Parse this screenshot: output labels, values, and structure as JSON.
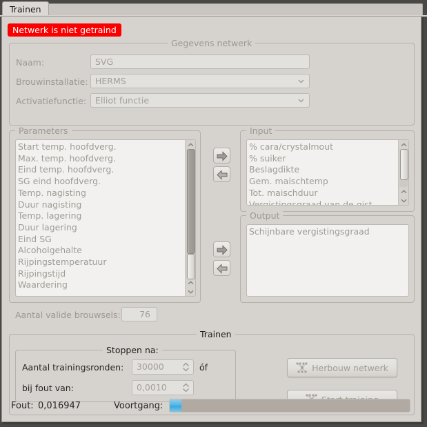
{
  "window": {
    "background_color": "#4a4846",
    "panel_color": "#d6d3ce"
  },
  "tabs": [
    {
      "label": "Trainen",
      "selected": true
    }
  ],
  "status_banner": {
    "text": "Netwerk is niet getraind",
    "background_color": "#fa0000",
    "text_color": "#ffffff"
  },
  "network_data_group": {
    "title": "Gegevens netwerk",
    "fields": [
      {
        "label": "Naam:",
        "value": "SVG",
        "type": "text"
      },
      {
        "label": "Brouwinstallatie:",
        "value": "HERMS",
        "type": "combobox"
      },
      {
        "label": "Activatiefunctie:",
        "value": "Elliot functie",
        "type": "combobox"
      }
    ]
  },
  "parameters_group": {
    "title": "Parameters",
    "items": [
      "Start temp. hoofdverg.",
      "Max. temp. hoofdverg.",
      "Eind temp. hoofdverg.",
      "SG eind hoofdverg.",
      "Temp. nagisting",
      "Duur nagisting",
      "Temp. lagering",
      "Duur lagering",
      "Eind SG",
      "Alcoholgehalte",
      "Rijpingstemperatuur",
      "Rijpingstijd",
      "Waardering"
    ]
  },
  "input_group": {
    "title": "Input",
    "items": [
      "% cara/crystalmout",
      "% suiker",
      "Beslagdikte",
      "Gem. maischtemp",
      "Tot. maischduur",
      "Vergistingsgraad van de gist"
    ]
  },
  "output_group": {
    "title": "Output",
    "items": [
      "Schijnbare vergistingsgraad"
    ]
  },
  "transfer_buttons": {
    "input_add": "right-arrow-icon",
    "input_remove": "left-arrow-icon",
    "output_add": "right-arrow-icon",
    "output_remove": "left-arrow-icon"
  },
  "valid_brews": {
    "label": "Aantal valide brouwsels:",
    "value": "76"
  },
  "training_group": {
    "title": "Trainen",
    "stop_group": {
      "title": "Stoppen na:",
      "rounds": {
        "label": "Aantal trainingsronden:",
        "value": "30000"
      },
      "or_label": "óf",
      "error": {
        "label": "bij fout van:",
        "value": "0,0010"
      }
    },
    "buttons": [
      {
        "label": "Herbouw netwerk",
        "icon": "neural-network-icon",
        "enabled": false
      },
      {
        "label": "Start training",
        "icon": "neural-network-icon",
        "enabled": false
      }
    ],
    "status": {
      "error_label": "Fout:",
      "error_value": "0,016947",
      "progress_label": "Voortgang:",
      "progress_percent": 5,
      "progress_color": "#57b6e4"
    }
  }
}
